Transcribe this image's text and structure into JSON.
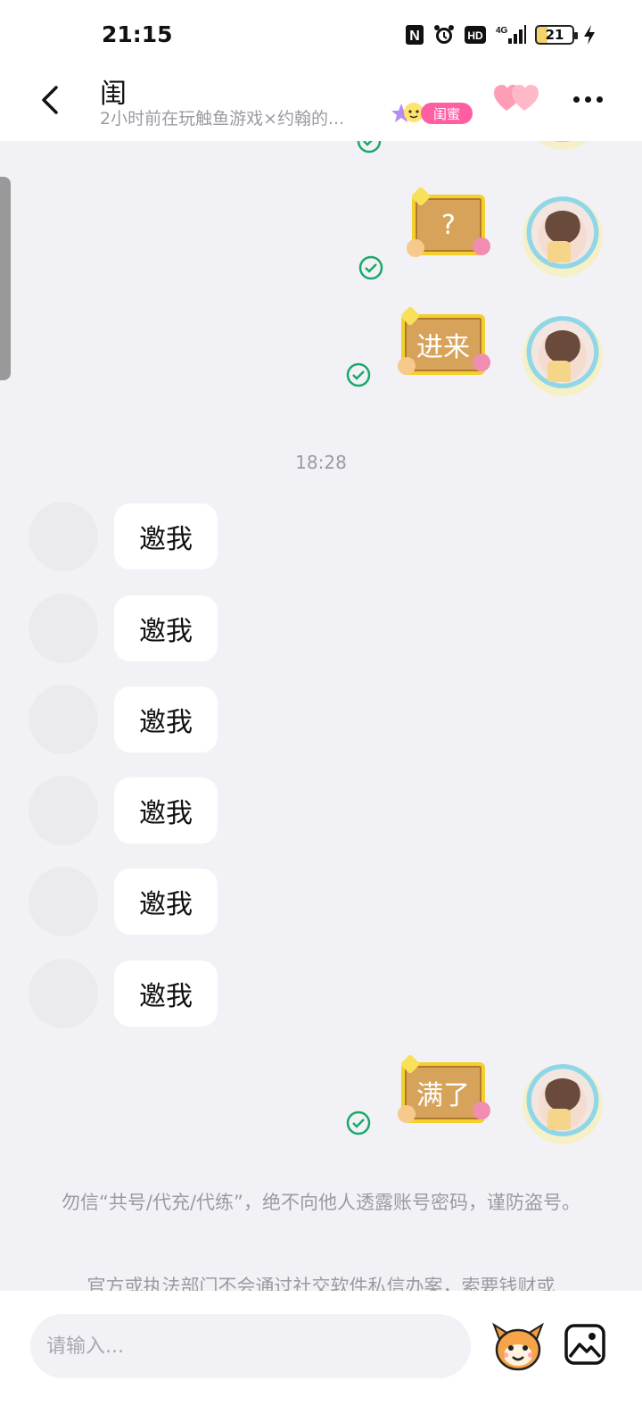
{
  "status_bar": {
    "time": "21:15",
    "icons": [
      "nfc-icon",
      "alarm-icon",
      "hd-icon",
      "4g-signal-icon",
      "battery-icon",
      "charging-icon"
    ],
    "nfc": "N",
    "hd": "HD",
    "network": "4G",
    "battery": "21"
  },
  "header": {
    "name": "闺",
    "status": "2小时前在玩触鱼游戏×约翰的...",
    "badge_label": "闺蜜",
    "colors": {
      "badge": "#ff5ea3",
      "heart": "#ff8fa8"
    }
  },
  "messages_out_top": [
    {
      "text": "?",
      "read": true
    },
    {
      "text": "进来",
      "read": true
    }
  ],
  "timestamp": "18:28",
  "messages_in": [
    {
      "text": "邀我"
    },
    {
      "text": "邀我"
    },
    {
      "text": "邀我"
    },
    {
      "text": "邀我"
    },
    {
      "text": "邀我"
    },
    {
      "text": "邀我"
    }
  ],
  "messages_out_bottom": [
    {
      "text": "满了",
      "read": true
    }
  ],
  "notices": {
    "line1": "勿信“共号/代充/代练”，绝不向他人透露账号密码，谨防盗号。",
    "line2": "官方或执法部门不会通过社交软件私信办案，索要钱财或"
  },
  "input": {
    "placeholder": "请输入..."
  },
  "colors": {
    "read_check": "#1aa86b",
    "sticker_fill": "#d7a35a",
    "sticker_border": "#f5d02c"
  }
}
